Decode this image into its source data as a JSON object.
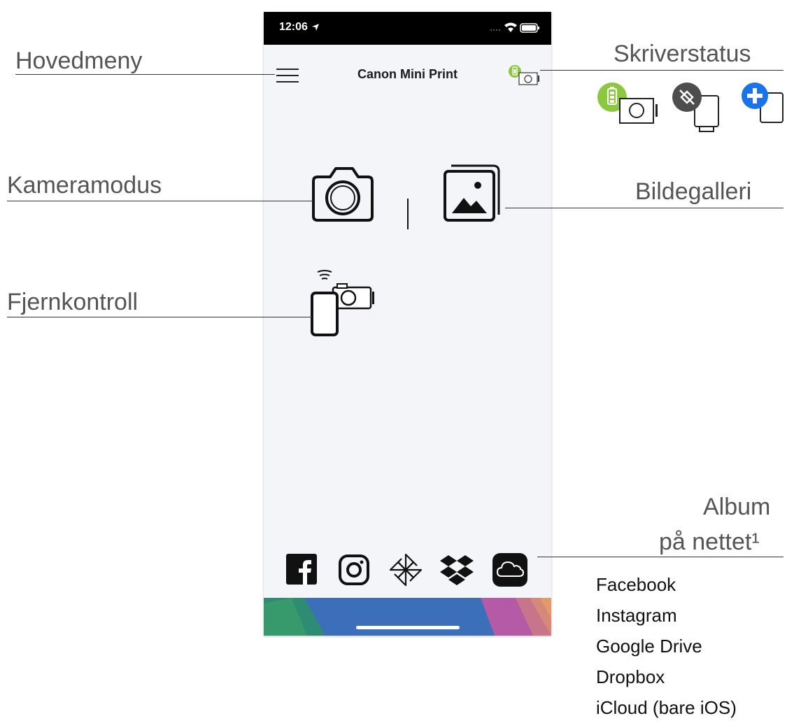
{
  "labels": {
    "main_menu": "Hovedmeny",
    "printer_status": "Skriverstatus",
    "camera_mode": "Kameramodus",
    "image_gallery": "Bildegalleri",
    "remote_control": "Fjernkontroll",
    "online_albums_line1": "Album",
    "online_albums_line2": "på nettet¹"
  },
  "phone": {
    "status_time": "12:06",
    "app_title": "Canon Mini Print"
  },
  "online_services": [
    "Facebook",
    "Instagram",
    "Google Drive",
    "Dropbox",
    "iCloud (bare iOS)"
  ],
  "icons": {
    "menu": "hamburger-menu-icon",
    "printer_connected": "printer-connected-battery-icon",
    "printer_disconnected": "printer-disconnected-icon",
    "printer_add": "printer-add-icon",
    "camera": "camera-icon",
    "gallery": "gallery-icon",
    "remote": "remote-control-icon",
    "facebook": "facebook-icon",
    "instagram": "instagram-icon",
    "google_drive": "google-drive-icon",
    "dropbox": "dropbox-icon",
    "icloud": "icloud-icon"
  },
  "colors": {
    "battery_green": "#8dc63f",
    "disconnected_gray": "#4d4d4d",
    "add_blue": "#1a73e8",
    "bottom_blue": "#3b6fb9"
  }
}
